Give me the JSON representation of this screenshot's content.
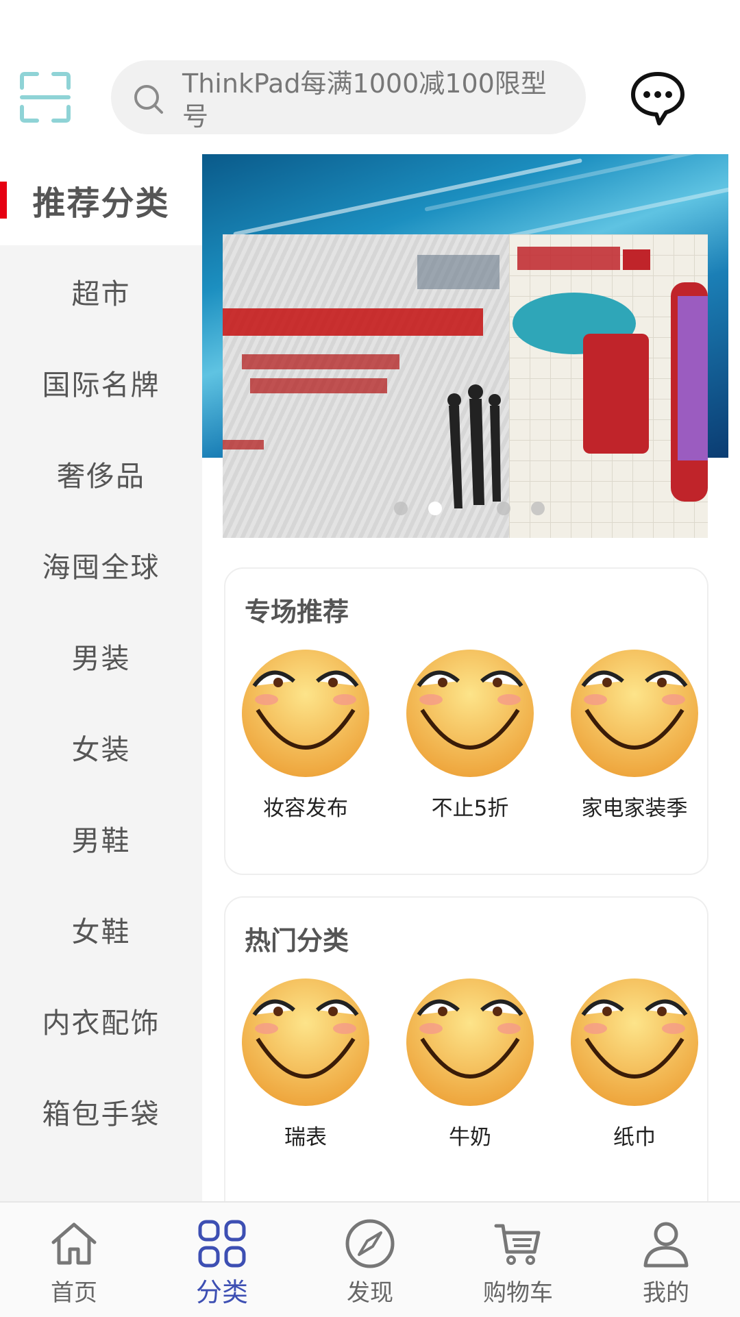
{
  "search": {
    "placeholder": "ThinkPad每满1000减100限型号"
  },
  "sidebar": {
    "items": [
      {
        "label": "推荐分类",
        "active": true
      },
      {
        "label": "超市"
      },
      {
        "label": "国际名牌"
      },
      {
        "label": "奢侈品"
      },
      {
        "label": "海囤全球"
      },
      {
        "label": "男装"
      },
      {
        "label": "女装"
      },
      {
        "label": "男鞋"
      },
      {
        "label": "女鞋"
      },
      {
        "label": "内衣配饰"
      },
      {
        "label": "箱包手袋"
      }
    ]
  },
  "banner": {
    "slide_count": 4,
    "active_slide": 1
  },
  "sections": [
    {
      "title": "专场推荐",
      "items": [
        {
          "label": "妆容发布",
          "icon": "smiley-icon"
        },
        {
          "label": "不止5折",
          "icon": "smiley-icon"
        },
        {
          "label": "家电家装季",
          "icon": "smiley-icon"
        }
      ]
    },
    {
      "title": "热门分类",
      "items": [
        {
          "label": "瑞表",
          "icon": "smiley-icon"
        },
        {
          "label": "牛奶",
          "icon": "smiley-icon"
        },
        {
          "label": "纸巾",
          "icon": "smiley-icon"
        }
      ]
    }
  ],
  "tabbar": {
    "items": [
      {
        "label": "首页",
        "icon": "home-icon"
      },
      {
        "label": "分类",
        "icon": "category-icon",
        "active": true
      },
      {
        "label": "发现",
        "icon": "compass-icon"
      },
      {
        "label": "购物车",
        "icon": "cart-icon"
      },
      {
        "label": "我的",
        "icon": "user-icon"
      }
    ]
  },
  "colors": {
    "accent": "#3d4fb3",
    "active_bar": "#e60012",
    "scan_icon": "#8fd3d6"
  }
}
